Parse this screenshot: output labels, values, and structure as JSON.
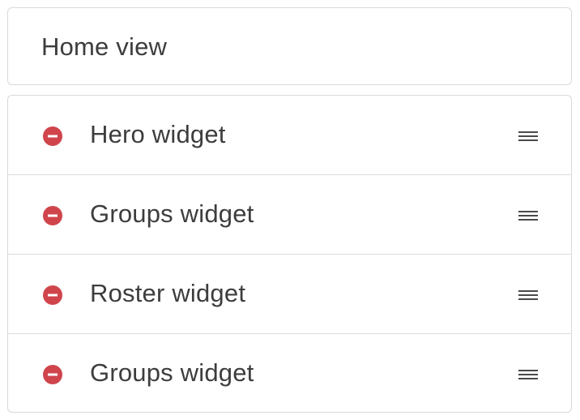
{
  "header": {
    "title": "Home view"
  },
  "widgets": [
    {
      "label": "Hero widget",
      "remove_icon": "remove-circle-icon",
      "handle_icon": "drag-handle-icon"
    },
    {
      "label": "Groups widget",
      "remove_icon": "remove-circle-icon",
      "handle_icon": "drag-handle-icon"
    },
    {
      "label": "Roster widget",
      "remove_icon": "remove-circle-icon",
      "handle_icon": "drag-handle-icon"
    },
    {
      "label": "Groups widget",
      "remove_icon": "remove-circle-icon",
      "handle_icon": "drag-handle-icon"
    }
  ],
  "colors": {
    "remove": "#d0454c",
    "text": "#3d3d3d",
    "border": "#d9d9d9",
    "handle": "#4a4a4a"
  }
}
